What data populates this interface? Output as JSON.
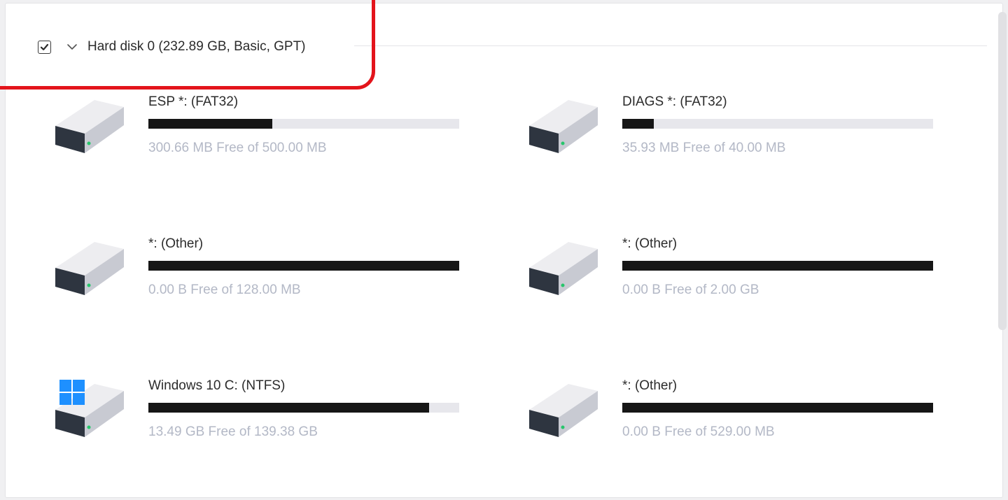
{
  "disk": {
    "title": "Hard disk 0 (232.89 GB, Basic, GPT)",
    "checked": true
  },
  "partitions": [
    {
      "name": "ESP *: (FAT32)",
      "free_text": "300.66 MB Free of 500.00 MB",
      "used_fraction": 0.399,
      "icon": "drive-icon"
    },
    {
      "name": "DIAGS *: (FAT32)",
      "free_text": "35.93 MB Free of 40.00 MB",
      "used_fraction": 0.102,
      "icon": "drive-icon"
    },
    {
      "name": "*: (Other)",
      "free_text": "0.00 B Free of 128.00 MB",
      "used_fraction": 1.0,
      "icon": "drive-icon"
    },
    {
      "name": "*: (Other)",
      "free_text": "0.00 B Free of 2.00 GB",
      "used_fraction": 1.0,
      "icon": "drive-icon"
    },
    {
      "name": "Windows 10 C: (NTFS)",
      "free_text": "13.49 GB Free of 139.38 GB",
      "used_fraction": 0.903,
      "icon": "windows-drive-icon"
    },
    {
      "name": "*: (Other)",
      "free_text": "0.00 B Free of 529.00 MB",
      "used_fraction": 1.0,
      "icon": "drive-icon"
    }
  ],
  "colors": {
    "bar_fill": "#161616",
    "bar_track": "#e7e7ec",
    "free_text": "#b3b8c6",
    "highlight": "#e3141b",
    "windows_logo": "#1e90ff"
  }
}
